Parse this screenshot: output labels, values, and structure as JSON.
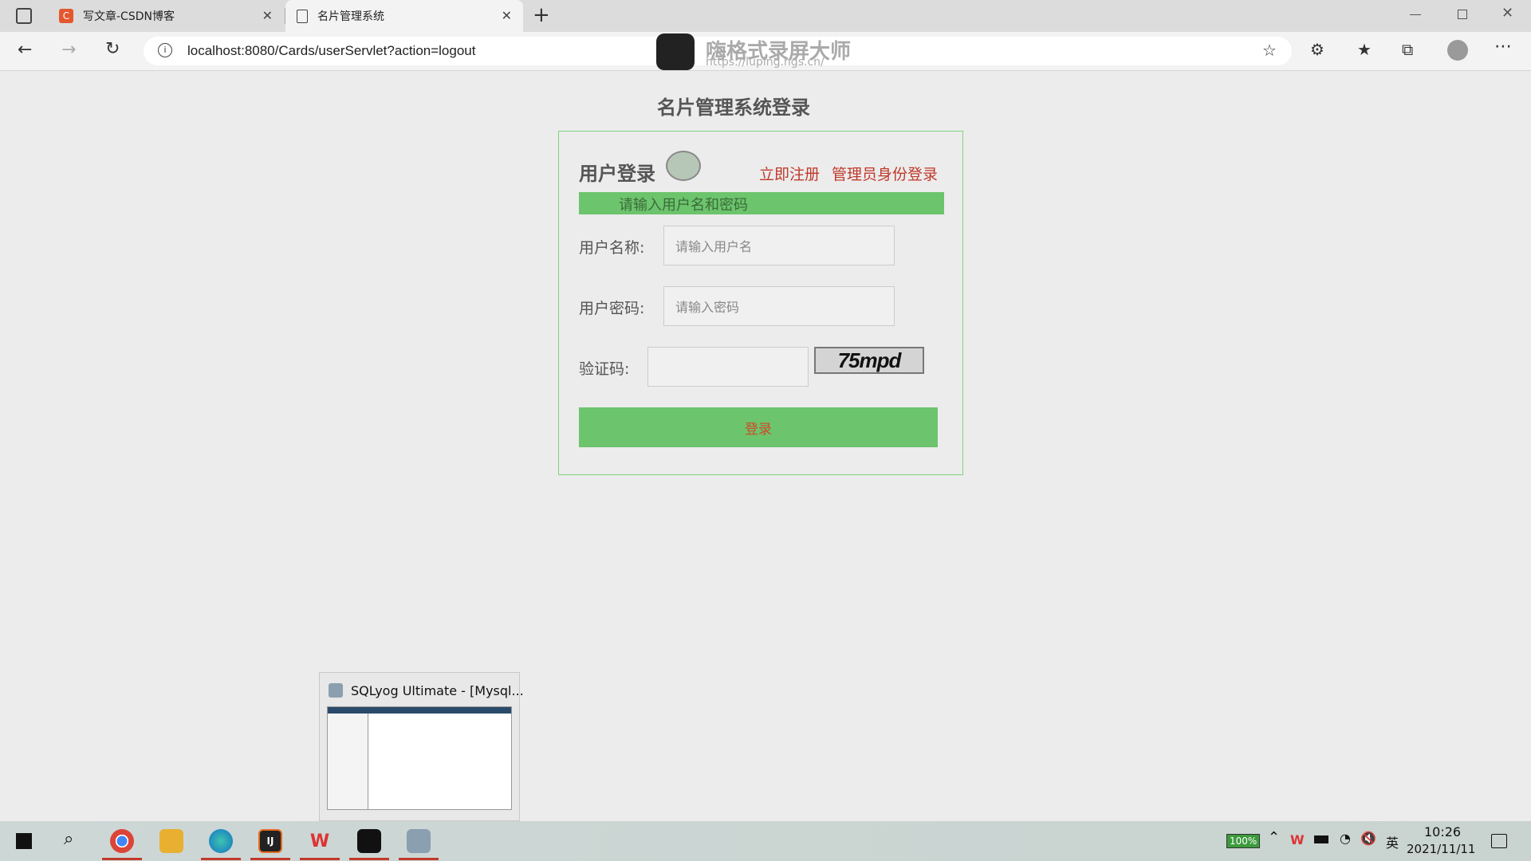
{
  "browser": {
    "tabs": [
      {
        "label": "写文章-CSDN博客",
        "icon": "csdn-icon"
      },
      {
        "label": "名片管理系统",
        "icon": "page-icon"
      }
    ],
    "new_tab": "+",
    "url": "localhost:8080/Cards/userServlet?action=logout",
    "window_controls": [
      "minimize",
      "restore",
      "close"
    ]
  },
  "watermark": {
    "title": "嗨格式录屏大师",
    "url": "https://luping.hgs.cn/"
  },
  "page": {
    "title": "名片管理系统登录",
    "login_heading": "用户登录",
    "register_link": "立即注册",
    "admin_link": "管理员身份登录",
    "hint": "请输入用户名和密码",
    "username_label": "用户名称:",
    "username_placeholder": "请输入用户名",
    "password_label": "用户密码:",
    "password_placeholder": "请输入密码",
    "captcha_label": "验证码:",
    "captcha_text": "75mpd",
    "login_button": "登录"
  },
  "taskbar": {
    "thumbnail_title": "SQLyog Ultimate - [Mysql...",
    "battery": "100%",
    "ime": "英",
    "time": "10:26",
    "date": "2021/11/11",
    "apps": [
      "chrome-icon",
      "folder-icon",
      "edge-icon",
      "intellij-icon",
      "wps-icon",
      "recorder-icon",
      "sqlyog-icon"
    ]
  },
  "colors": {
    "accent_green": "#6cc46c",
    "link_red": "#c0392b"
  }
}
